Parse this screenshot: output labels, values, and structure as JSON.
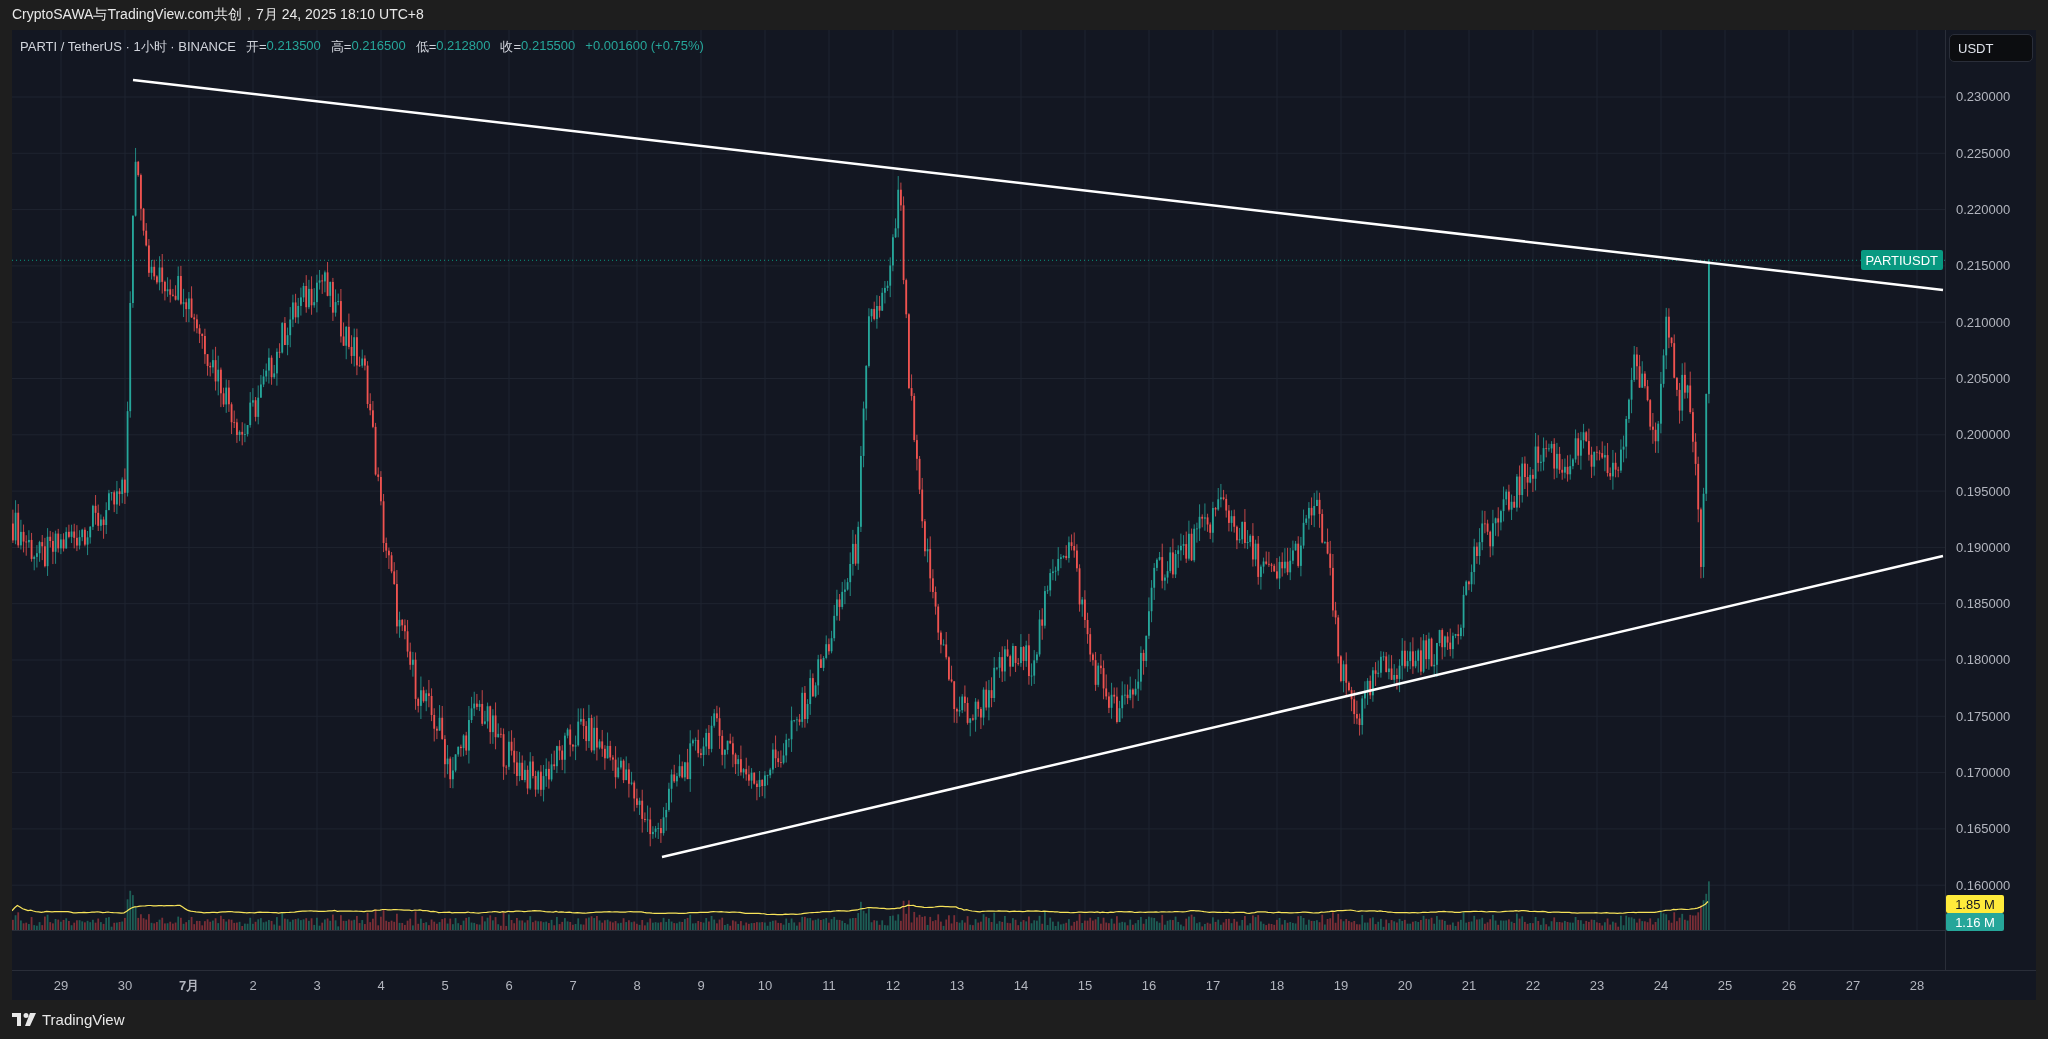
{
  "title": "CryptoSAWA与TradingView.com共创，7月 24, 2025 18:10 UTC+8",
  "legend": {
    "symbol": "PARTI / TetherUS · 1小时 · BINANCE",
    "fields": [
      {
        "label": "开=",
        "value": "0.213500"
      },
      {
        "label": "高=",
        "value": "0.216500"
      },
      {
        "label": "低=",
        "value": "0.212800"
      },
      {
        "label": "收=",
        "value": "0.215500"
      }
    ],
    "change": "+0.001600 (+0.75%)"
  },
  "currency_button": "USDT",
  "price_axis": [
    "0.230000",
    "0.225000",
    "0.220000",
    "0.215000",
    "0.210000",
    "0.205000",
    "0.200000",
    "0.195000",
    "0.190000",
    "0.185000",
    "0.180000",
    "0.175000",
    "0.170000",
    "0.165000",
    "0.160000"
  ],
  "last_price_badge": "PARTIUSDT",
  "volume_badges": [
    {
      "text": "1.85 M",
      "color": "#ffeb3b"
    },
    {
      "text": "1.16 M",
      "color": "#26a69a"
    }
  ],
  "time_axis": [
    {
      "label": "29",
      "bold": false
    },
    {
      "label": "30",
      "bold": false
    },
    {
      "label": "7月",
      "bold": true
    },
    {
      "label": "2",
      "bold": false
    },
    {
      "label": "3",
      "bold": false
    },
    {
      "label": "4",
      "bold": false
    },
    {
      "label": "5",
      "bold": false
    },
    {
      "label": "6",
      "bold": false
    },
    {
      "label": "7",
      "bold": false
    },
    {
      "label": "8",
      "bold": false
    },
    {
      "label": "9",
      "bold": false
    },
    {
      "label": "10",
      "bold": false
    },
    {
      "label": "11",
      "bold": false
    },
    {
      "label": "12",
      "bold": false
    },
    {
      "label": "13",
      "bold": false
    },
    {
      "label": "14",
      "bold": false
    },
    {
      "label": "15",
      "bold": false
    },
    {
      "label": "16",
      "bold": false
    },
    {
      "label": "17",
      "bold": false
    },
    {
      "label": "18",
      "bold": false
    },
    {
      "label": "19",
      "bold": false
    },
    {
      "label": "20",
      "bold": false
    },
    {
      "label": "21",
      "bold": false
    },
    {
      "label": "22",
      "bold": false
    },
    {
      "label": "23",
      "bold": false
    },
    {
      "label": "24",
      "bold": false
    },
    {
      "label": "25",
      "bold": false
    },
    {
      "label": "26",
      "bold": false
    },
    {
      "label": "27",
      "bold": false
    },
    {
      "label": "28",
      "bold": false
    }
  ],
  "brand": "TradingView"
}
